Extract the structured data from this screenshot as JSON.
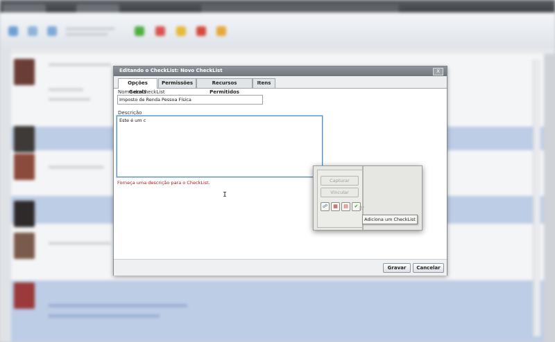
{
  "dialog": {
    "title": "Editando o CheckList: Novo CheckList",
    "close_label": "X",
    "tabs": [
      "Opções Gerais",
      "Permissões",
      "Recursos Permitidos",
      "Itens"
    ],
    "nome_label": "Nome do CheckList",
    "nome_value": "Imposto de Renda Pessoa Física",
    "descricao_label": "Descrição",
    "descricao_value": "Este é um c",
    "error": "Forneça uma descrição para o CheckList.",
    "save_label": "Gravar",
    "cancel_label": "Cancelar"
  },
  "popup": {
    "capturar_label": "Capturar",
    "vincular_label": "Vincular",
    "icons": [
      "attach-icon",
      "calendar-icon",
      "document-icon",
      "checklist-icon"
    ],
    "tooltip": "Adiciona um CheckList"
  },
  "colors": {
    "error": "#b01818",
    "focus_border": "#4d8fd1",
    "checklist_green": "#2e9e2e"
  }
}
